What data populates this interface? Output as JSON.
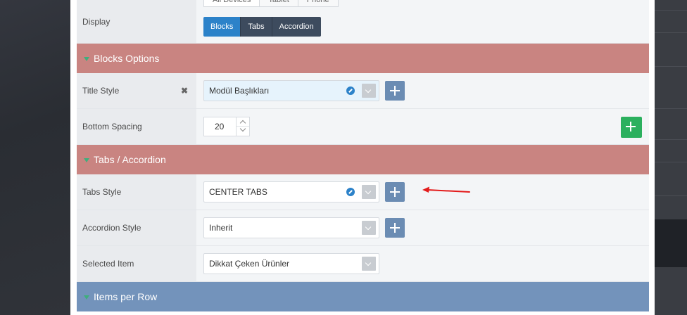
{
  "device_tabs": [
    "All Devices",
    "Tablet",
    "Phone"
  ],
  "display": {
    "label": "Display",
    "options": [
      "Blocks",
      "Tabs",
      "Accordion"
    ],
    "selected": "Blocks"
  },
  "sections": {
    "blocks_options": "Blocks Options",
    "tabs_accordion": "Tabs / Accordion",
    "items_per_row": "Items per Row"
  },
  "title_style": {
    "label": "Title Style",
    "value": "Modül Başlıkları"
  },
  "bottom_spacing": {
    "label": "Bottom Spacing",
    "value": "20"
  },
  "tabs_style": {
    "label": "Tabs Style",
    "value": "CENTER TABS"
  },
  "accordion_style": {
    "label": "Accordion Style",
    "value": "Inherit"
  },
  "selected_item": {
    "label": "Selected Item",
    "value": "Dikkat Çeken Ürünler"
  },
  "colors": {
    "section_red": "#c98481",
    "section_blue": "#7393bb",
    "add_button": "#6b8cb3",
    "add_button_green": "#2bb05e",
    "active_segment": "#2c82c9",
    "annotation_arrow": "#e31b1b"
  },
  "icons": {
    "remove": "close-x-icon",
    "clear": "edit-dot-icon",
    "dropdown": "chevron-down-icon",
    "add": "plus-icon",
    "annotation": "red-arrow-left"
  }
}
